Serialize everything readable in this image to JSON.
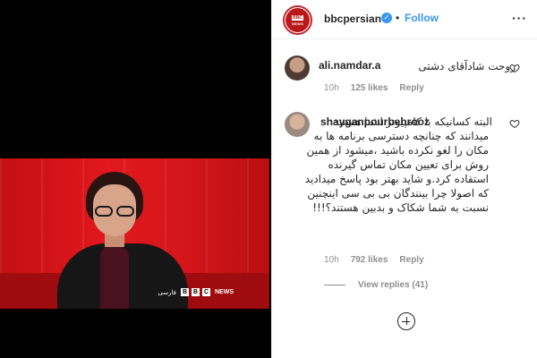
{
  "post": {
    "account": "bbcpersian",
    "follow_label": "Follow",
    "dot": "•",
    "more_label": "···",
    "avatar_logo_text": "BBC",
    "avatar_logo_sub": "NEWS",
    "verified_icon": "✓"
  },
  "video": {
    "lower_third_fa": "فارسی",
    "lower_third_blocks": [
      "B",
      "B",
      "C"
    ],
    "lower_third_news": "NEWS"
  },
  "comments": [
    {
      "username": "ali.namdar.a",
      "text": "روحت شادآقای دشتی",
      "time": "10h",
      "likes": "125 likes",
      "reply_label": "Reply"
    },
    {
      "username": "shayganpourbehrooz",
      "text": "البته کسانیکه با کامپیوتر اشنا هستند میدانند که چنانچه دسترسی برنامه ها به مکان را لغو نکرده باشید ،میشود از همین روش برای تعیین مکان تماس گیرنده استفاده کرد.و شاید بهتر بود پاسخ میدادید که اصولا چرا بینندگان بی بی سی اینچنین نسبت به شما شکاک و بدبین هستند؟!!!",
      "time": "10h",
      "likes": "792 likes",
      "reply_label": "Reply"
    }
  ],
  "view_replies_label": "View replies (41)",
  "colors": {
    "accent": "#3897f0",
    "muted": "#8e8e8e",
    "text": "#262626",
    "bbc_red": "#bb1919"
  },
  "icons": {
    "header_avatar": "bbc-news-logo",
    "verified": "verified-badge-icon",
    "more": "more-options-icon",
    "like": "heart-icon",
    "load_more": "plus-circle-icon"
  }
}
